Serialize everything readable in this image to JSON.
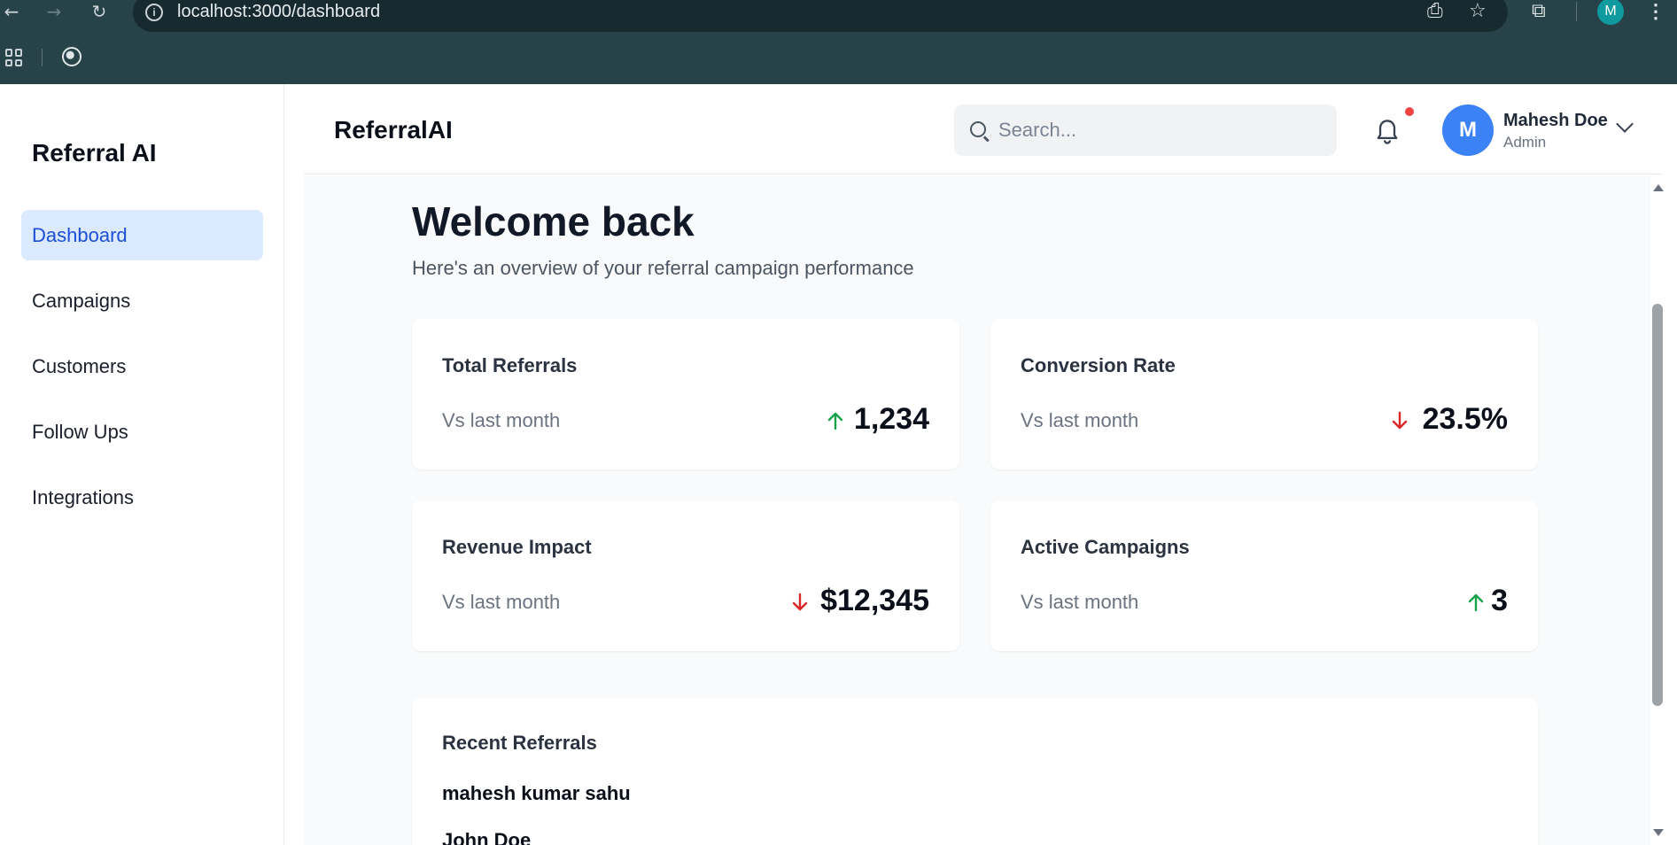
{
  "browser": {
    "url": "localhost:3000/dashboard",
    "profile_initial": "M",
    "icons": [
      "back-icon",
      "forward-icon",
      "reload-icon",
      "site-info-icon",
      "install-app-icon",
      "bookmark-star-icon",
      "extensions-icon",
      "menu-icon",
      "apps-grid-icon",
      "globe-icon"
    ]
  },
  "sidebar": {
    "brand": "Referral AI",
    "items": [
      {
        "label": "Dashboard",
        "active": true
      },
      {
        "label": "Campaigns",
        "active": false
      },
      {
        "label": "Customers",
        "active": false
      },
      {
        "label": "Follow Ups",
        "active": false
      },
      {
        "label": "Integrations",
        "active": false
      }
    ]
  },
  "header": {
    "app_title": "ReferralAI",
    "search_placeholder": "Search...",
    "user": {
      "initial": "M",
      "name": "Mahesh Doe",
      "role": "Admin"
    }
  },
  "main": {
    "welcome": "Welcome back",
    "subtitle": "Here's an overview of your referral campaign performance",
    "stats": [
      {
        "title": "Total Referrals",
        "sub": "Vs last month",
        "value": "1,234",
        "trend": "up"
      },
      {
        "title": "Conversion Rate",
        "sub": "Vs last month",
        "value": "23.5%",
        "trend": "down"
      },
      {
        "title": "Revenue Impact",
        "sub": "Vs last month",
        "value": "$12,345",
        "trend": "down"
      },
      {
        "title": "Active Campaigns",
        "sub": "Vs last month",
        "value": "3",
        "trend": "up"
      }
    ],
    "recent": {
      "title": "Recent Referrals",
      "items": [
        "mahesh kumar sahu",
        "John Doe"
      ]
    }
  },
  "colors": {
    "active_nav_bg": "#dbeafe",
    "active_nav_text": "#1d4ed8",
    "trend_up": "#16a34a",
    "trend_down": "#dc2626",
    "avatar": "#3b82f6",
    "notification_dot": "#ef4444"
  }
}
